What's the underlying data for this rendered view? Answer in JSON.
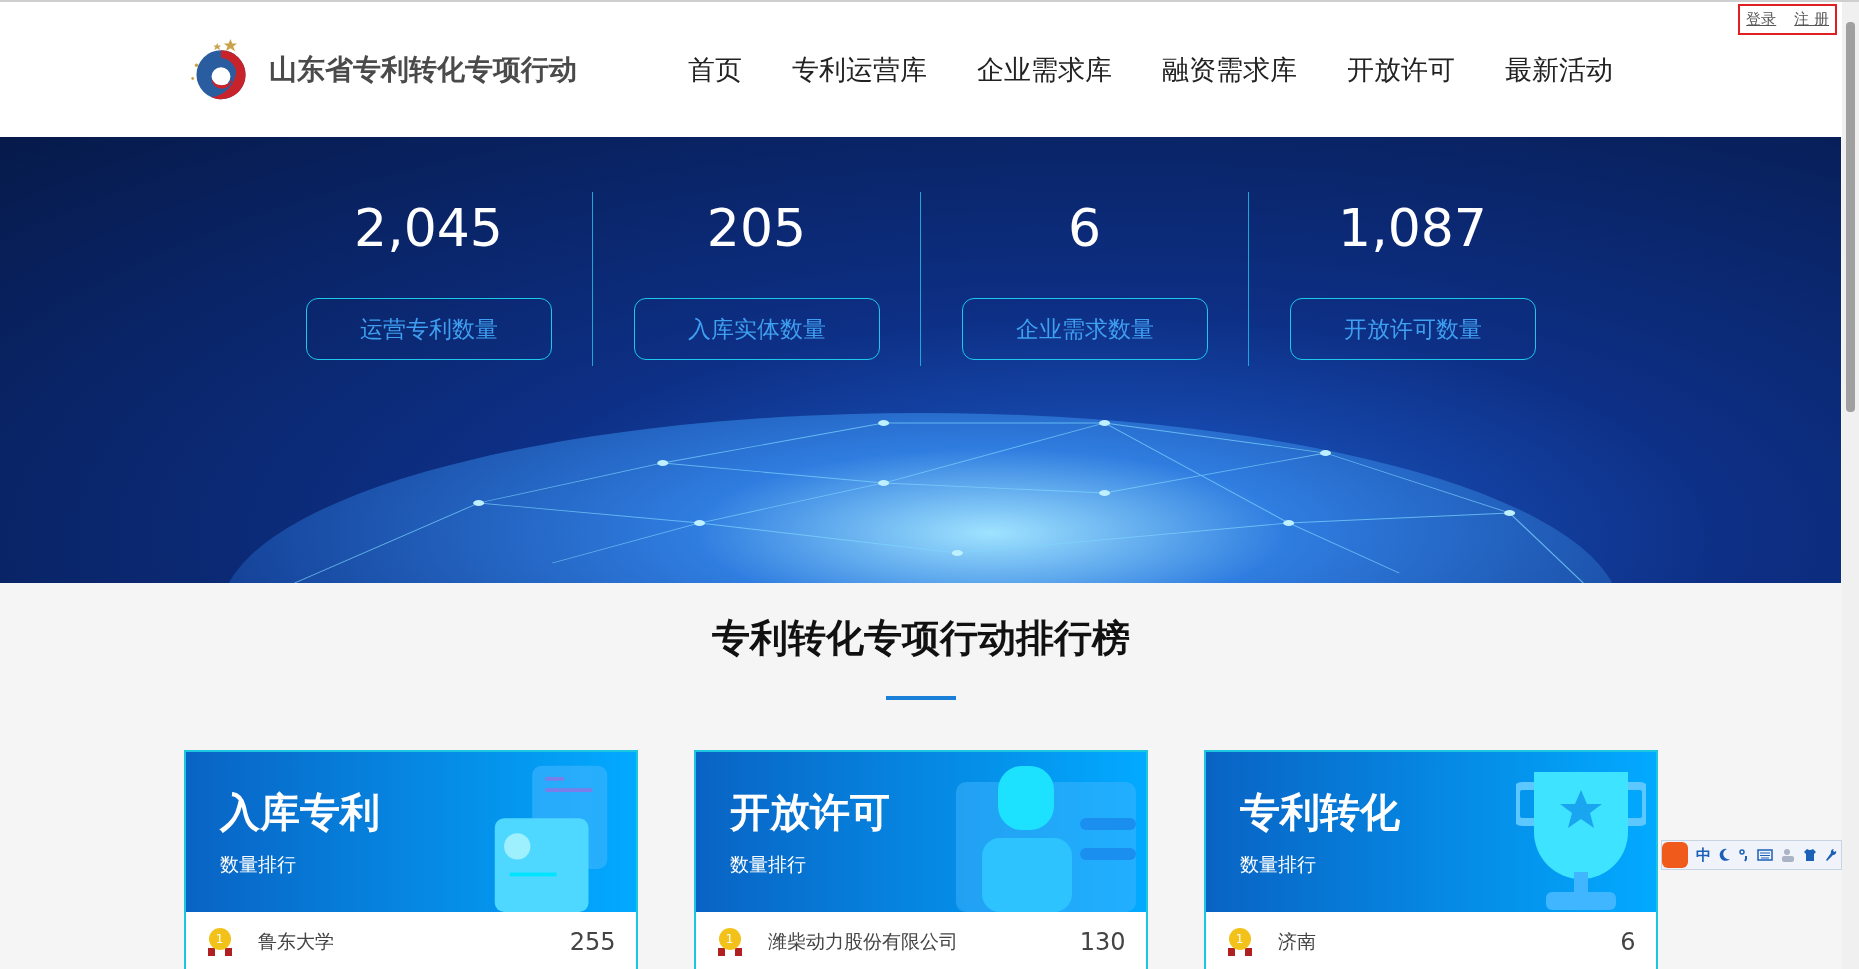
{
  "site": {
    "title": "山东省专利转化专项行动"
  },
  "nav": [
    {
      "label": "首页"
    },
    {
      "label": "专利运营库"
    },
    {
      "label": "企业需求库"
    },
    {
      "label": "融资需求库"
    },
    {
      "label": "开放许可"
    },
    {
      "label": "最新活动"
    }
  ],
  "account_links": [
    {
      "label": "登录"
    },
    {
      "label": "注 册"
    }
  ],
  "stats": [
    {
      "value": "2,045",
      "label": "运营专利数量"
    },
    {
      "value": "205",
      "label": "入库实体数量"
    },
    {
      "value": "6",
      "label": "企业需求数量"
    },
    {
      "value": "1,087",
      "label": "开放许可数量"
    }
  ],
  "ranking": {
    "title": "专利转化专项行动排行榜",
    "cards": [
      {
        "kind": "document",
        "title": "入库专利",
        "subtitle": "数量排行",
        "rows": [
          {
            "rank": "1",
            "name": "鲁东大学",
            "value": "255"
          }
        ]
      },
      {
        "kind": "person",
        "title": "开放许可",
        "subtitle": "数量排行",
        "rows": [
          {
            "rank": "1",
            "name": "潍柴动力股份有限公司",
            "value": "130"
          }
        ]
      },
      {
        "kind": "trophy",
        "title": "专利转化",
        "subtitle": "数量排行",
        "rows": [
          {
            "rank": "1",
            "name": "济南",
            "value": "6"
          }
        ]
      }
    ]
  },
  "ime_toolbar": {
    "mode": "中"
  }
}
